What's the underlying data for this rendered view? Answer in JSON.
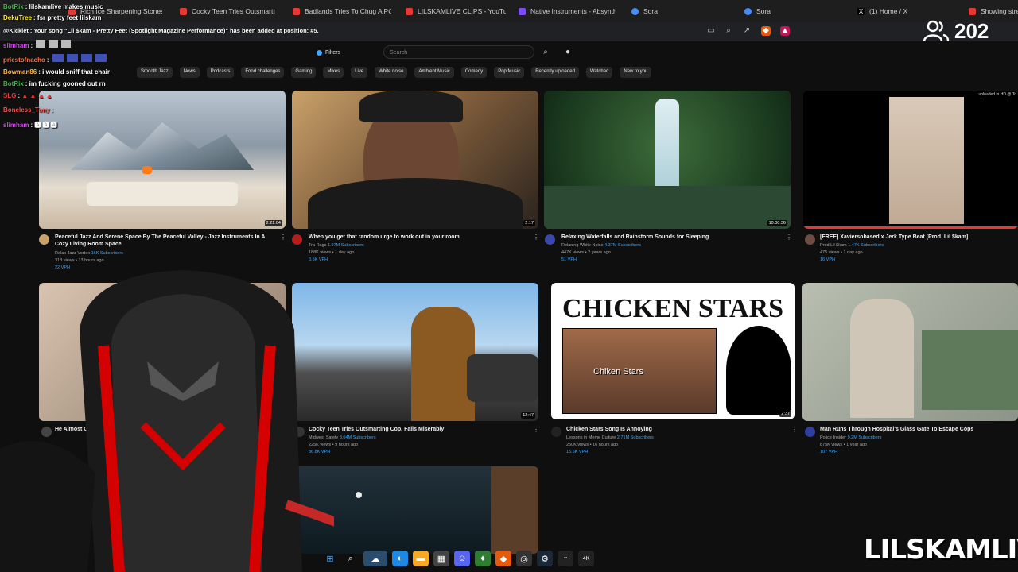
{
  "tabs": [
    {
      "label": "Rich Ice Sharpening Stones - YouTube",
      "color": "#e53935"
    },
    {
      "label": "Cocky Teen Tries Outsmarting",
      "color": "#e53935"
    },
    {
      "label": "Badlands Tries To Chug A PON",
      "color": "#e53935"
    },
    {
      "label": "LILSKAMLIVE CLIPS - YouTube",
      "color": "#e53935"
    },
    {
      "label": "Native Instruments - Absynth 5",
      "color": "#7c4dff"
    },
    {
      "label": "Sora",
      "color": "#4a8cf7"
    },
    {
      "label": "Sora",
      "color": "#4a8cf7"
    },
    {
      "label": "(1) Home / X",
      "color": "#ffffff"
    },
    {
      "label": "Showing stre",
      "color": "#e53935"
    }
  ],
  "viewers": {
    "count": "202"
  },
  "youtube": {
    "filters_label": "Filters",
    "search_placeholder": "Search",
    "chips": [
      "Smooth Jazz",
      "News",
      "Podcasts",
      "Food challenges",
      "Gaming",
      "Mixes",
      "Live",
      "White noise",
      "Ambient Music",
      "Comedy",
      "Pop Music",
      "Recently uploaded",
      "Watched",
      "New to you"
    ],
    "videos": [
      {
        "title": "Peaceful Jazz And Serene Space By The Peaceful Valley - Jazz Instruments In A Cozy Living Room Space",
        "channel": "Relax Jazz Vortex",
        "subs": "16K Subscribers",
        "meta": "318 views • 13 hours ago",
        "badge": "22 VPH",
        "duration": "2:21:04"
      },
      {
        "title": "When you get that random urge to work out in your room",
        "channel": "Tra Rags",
        "subs": "1.97M Subscribers",
        "meta": "188K views • 1 day ago",
        "badge": "3.5K VPH",
        "duration": "2:17"
      },
      {
        "title": "Relaxing Waterfalls and Rainstorm Sounds for Sleeping",
        "channel": "Relaxing White Noise",
        "subs": "4.37M Subscribers",
        "meta": "447K views • 2 years ago",
        "badge": "51 VPH",
        "duration": "10:00:36"
      },
      {
        "title": "[FREE] Xaviersobased x Jerk Type Beat [Prod. Lil $kam]",
        "channel": "Prod Lil $kam",
        "subs": "1.47K Subscribers",
        "meta": "475 views • 1 day ago",
        "badge": "16 VPH",
        "duration": ""
      },
      {
        "title": "He Almost Got",
        "channel": "",
        "subs": "",
        "meta": "",
        "badge": "",
        "duration": ""
      },
      {
        "title": "Cocky Teen Tries Outsmarting Cop, Fails Miserably",
        "channel": "Midwest Safety",
        "subs": "3.04M Subscribers",
        "meta": "225K views • 9 hours ago",
        "badge": "36.8K VPH",
        "duration": "12:47"
      },
      {
        "title": "Chicken Stars Song Is Annoying",
        "channel": "Lessons in Meme Culture",
        "subs": "2.71M Subscribers",
        "meta": "250K views • 16 hours ago",
        "badge": "15.6K VPH",
        "duration": "2:37"
      },
      {
        "title": "Man Runs Through Hospital's Glass Gate To Escape Cops",
        "channel": "Police Insider",
        "subs": "9.2M Subscribers",
        "meta": "875K views • 1 year ago",
        "badge": "107 VPH",
        "duration": ""
      }
    ],
    "thumb_texts": {
      "chicken_title": "CHICKEN STARS",
      "chicken_caption": "Chiken Stars",
      "corner_text": "uploaded in HD @ To"
    }
  },
  "chat": [
    {
      "user": "BotRix",
      "msg": "lilskamlive makes music",
      "color": "#4caf50"
    },
    {
      "user": "DekuTree",
      "msg": "fsr pretty feet lilskam",
      "color": "#ffeb3b"
    },
    {
      "user": "@Kicklet",
      "msg": "Your song \"Lil $kam - Pretty Feet (Spotlight Magazine Performance)\" has been added at position: #5.",
      "color": "#ffffff"
    },
    {
      "user": "slimham",
      "msg": "",
      "color": "#e040fb"
    },
    {
      "user": "priestofnacho",
      "msg": "",
      "color": "#ff7043"
    },
    {
      "user": "Bowman86",
      "msg": "i would sniff that chair",
      "color": "#ffb74d"
    },
    {
      "user": "BotRix",
      "msg": "im fucking gooned out rn",
      "color": "#4caf50"
    },
    {
      "user": "SLG",
      "msg": "",
      "color": "#e53935"
    },
    {
      "user": "Boneless_Tony",
      "msg": "",
      "color": "#ef5350"
    },
    {
      "user": "slimham",
      "msg": "",
      "color": "#e040fb"
    }
  ],
  "brand": "LILSKAMLIVE"
}
